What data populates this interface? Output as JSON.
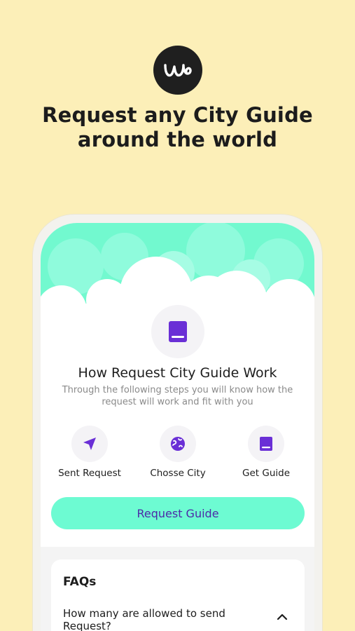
{
  "header": {
    "logo_icon": "we-logo-icon",
    "headline_line1": "Request any City Guide",
    "headline_line2": "around the world"
  },
  "card": {
    "main_icon": "book-icon",
    "title": "How Request City Guide Work",
    "description": "Through the following steps  you will know how the request will work and fit with you",
    "steps": [
      {
        "label": "Sent Request",
        "icon": "send-icon"
      },
      {
        "label": "Chosse City",
        "icon": "globe-icon"
      },
      {
        "label": "Get Guide",
        "icon": "book-icon"
      }
    ],
    "cta_label": "Request Guide"
  },
  "faq": {
    "title": "FAQs",
    "items": [
      {
        "question": "How many are allowed to send Request?",
        "toggle_icon": "chevron-up-icon"
      }
    ]
  },
  "colors": {
    "background": "#fcefb8",
    "accent_mint": "#6dfbd2",
    "accent_purple": "#6a2fd6",
    "cta_text": "#4c2aa8"
  }
}
